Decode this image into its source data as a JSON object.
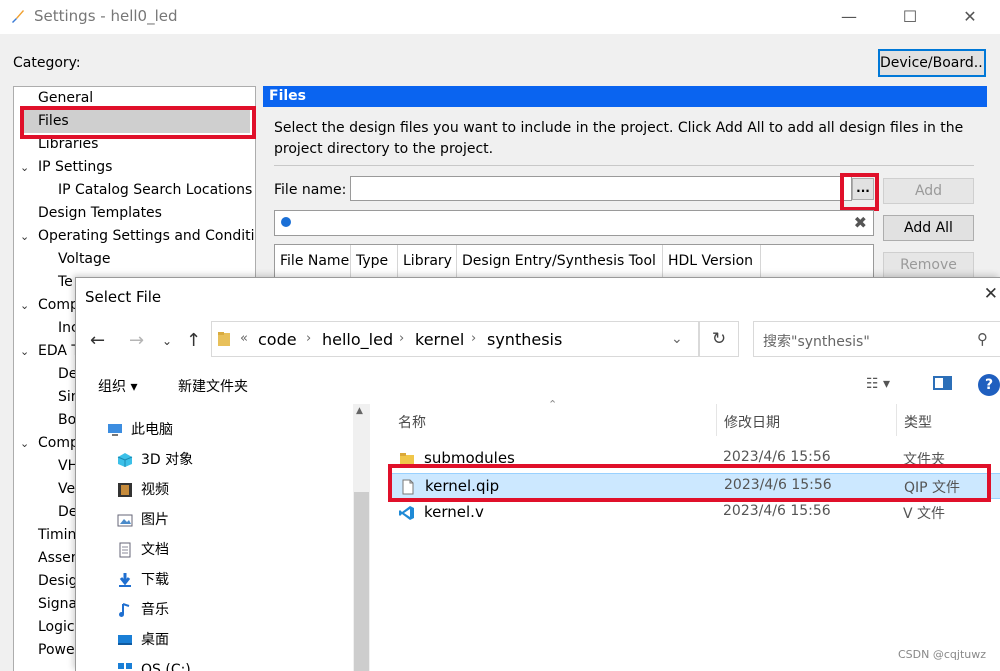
{
  "window": {
    "title": "Settings - hell0_led",
    "minimize": "—",
    "maximize": "☐",
    "close": "✕"
  },
  "category_label": "Category:",
  "device_button": "Device/Board...",
  "tree": [
    {
      "label": "General",
      "indent": 0
    },
    {
      "label": "Files",
      "indent": 0,
      "selected": true
    },
    {
      "label": "Libraries",
      "indent": 0
    },
    {
      "label": "IP Settings",
      "indent": 0,
      "expandable": true
    },
    {
      "label": "IP Catalog Search Locations",
      "indent": 1
    },
    {
      "label": "Design Templates",
      "indent": 0
    },
    {
      "label": "Operating Settings and Conditio",
      "indent": 0,
      "expandable": true
    },
    {
      "label": "Voltage",
      "indent": 1
    },
    {
      "label": "Te",
      "indent": 1
    },
    {
      "label": "Comp",
      "indent": 0,
      "expandable": true
    },
    {
      "label": "Inc",
      "indent": 1
    },
    {
      "label": "EDA T",
      "indent": 0,
      "expandable": true
    },
    {
      "label": "De",
      "indent": 1
    },
    {
      "label": "Sin",
      "indent": 1
    },
    {
      "label": "Bo",
      "indent": 1
    },
    {
      "label": "Comp",
      "indent": 0,
      "expandable": true
    },
    {
      "label": "VH",
      "indent": 1
    },
    {
      "label": "Ve",
      "indent": 1
    },
    {
      "label": "De",
      "indent": 1
    },
    {
      "label": "Timin",
      "indent": 0
    },
    {
      "label": "Asser",
      "indent": 0
    },
    {
      "label": "Desig",
      "indent": 0
    },
    {
      "label": "Signa",
      "indent": 0
    },
    {
      "label": "Logic",
      "indent": 0
    },
    {
      "label": "Powe",
      "indent": 0
    }
  ],
  "files_panel": {
    "header": "Files",
    "description": "Select the design files you want to include in the project. Click Add All to add all design files in the project directory to the project.",
    "file_name_label": "File name:",
    "file_name_value": "",
    "browse_label": "...",
    "filter_value": "",
    "buttons": {
      "add": "Add",
      "add_all": "Add All",
      "remove": "Remove"
    },
    "columns": [
      "File Name",
      "Type",
      "Library",
      "Design Entry/Synthesis Tool",
      "HDL Version"
    ]
  },
  "dialog": {
    "title": "Select File",
    "close": "✕",
    "path": [
      "code",
      "hello_led",
      "kernel",
      "synthesis"
    ],
    "path_overflow": "«",
    "search_placeholder": "搜索\"synthesis\"",
    "toolbar": {
      "organize": "组织 ▾",
      "new_folder": "新建文件夹"
    },
    "nav": [
      {
        "label": "此电脑",
        "icon": "computer-icon",
        "root": true
      },
      {
        "label": "3D 对象",
        "icon": "cube-icon"
      },
      {
        "label": "视频",
        "icon": "film-icon"
      },
      {
        "label": "图片",
        "icon": "picture-icon"
      },
      {
        "label": "文档",
        "icon": "document-icon"
      },
      {
        "label": "下载",
        "icon": "download-icon"
      },
      {
        "label": "音乐",
        "icon": "music-icon"
      },
      {
        "label": "桌面",
        "icon": "desktop-icon"
      },
      {
        "label": "OS (C:)",
        "icon": "drive-icon"
      }
    ],
    "columns": {
      "name": "名称",
      "modified": "修改日期",
      "type": "类型"
    },
    "files": [
      {
        "name": "submodules",
        "modified": "2023/4/6 15:56",
        "type": "文件夹",
        "icon": "folder-icon"
      },
      {
        "name": "kernel.qip",
        "modified": "2023/4/6 15:56",
        "type": "QIP 文件",
        "icon": "file-icon",
        "selected": true
      },
      {
        "name": "kernel.v",
        "modified": "2023/4/6 15:56",
        "type": "V 文件",
        "icon": "vscode-icon"
      }
    ]
  },
  "watermark": "CSDN @cqjtuwz",
  "colors": {
    "accent": "#0a64f0",
    "highlight": "#e0102a",
    "selection": "#cce8ff"
  }
}
